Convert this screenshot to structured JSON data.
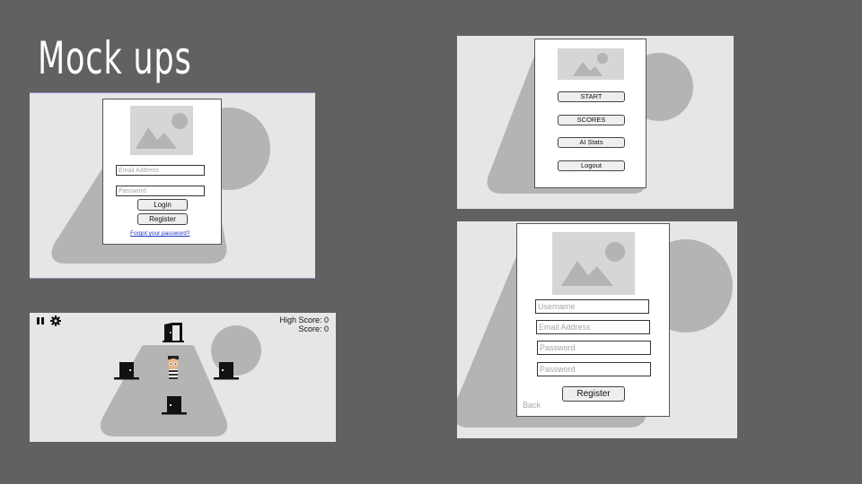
{
  "slide": {
    "title": "Mock ups"
  },
  "login_mockup": {
    "email_placeholder": "Email Address",
    "password_placeholder": "Password",
    "login_label": "Login",
    "register_label": "Register",
    "forgot_link": "Forgot your password?"
  },
  "menu_mockup": {
    "items": [
      "START",
      "SCORES",
      "AI Stats",
      "Logout"
    ]
  },
  "game_mockup": {
    "high_score": "High Score: 0",
    "score": "Score: 0",
    "icons": [
      "pause-icon",
      "gear-icon",
      "door-icon",
      "prisoner-icon"
    ]
  },
  "register_mockup": {
    "username_placeholder": "Username",
    "email_placeholder": "Email Address",
    "password_placeholder": "Password",
    "confirm_password_placeholder": "Password",
    "register_label": "Register",
    "back_label": "Back"
  },
  "colors": {
    "slide_background": "#616161",
    "panel_background": "#e6e6e6",
    "art_gray": "#b4b4b4",
    "link_blue": "#1a33c8"
  }
}
